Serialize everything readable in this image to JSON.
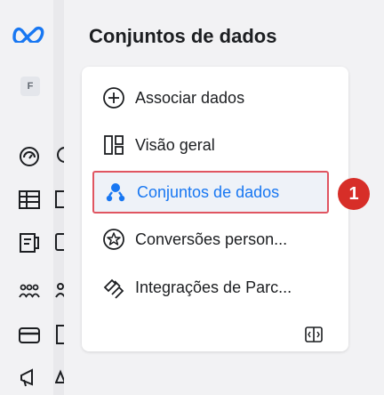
{
  "rail": {
    "logo": "meta-logo",
    "avatar_letter": "F",
    "icons": [
      "dashboard-icon",
      "table-icon",
      "reports-icon",
      "people-icon",
      "billing-icon",
      "megaphone-icon"
    ]
  },
  "header": {
    "title": "Conjuntos de dados"
  },
  "nav": {
    "items": [
      {
        "label": "Associar dados",
        "icon": "plus-circle-icon"
      },
      {
        "label": "Visão geral",
        "icon": "overview-icon"
      },
      {
        "label": "Conjuntos de dados",
        "icon": "datasets-icon",
        "selected": true
      },
      {
        "label": "Conversões person...",
        "icon": "conversions-icon"
      },
      {
        "label": "Integrações de Parc...",
        "icon": "integrations-icon"
      }
    ],
    "collapse_icon": "collapse-panel-icon"
  },
  "annotation": {
    "step": "1"
  },
  "colors": {
    "accent": "#1877f2",
    "highlight_border": "#e05561",
    "badge": "#d72e28"
  }
}
